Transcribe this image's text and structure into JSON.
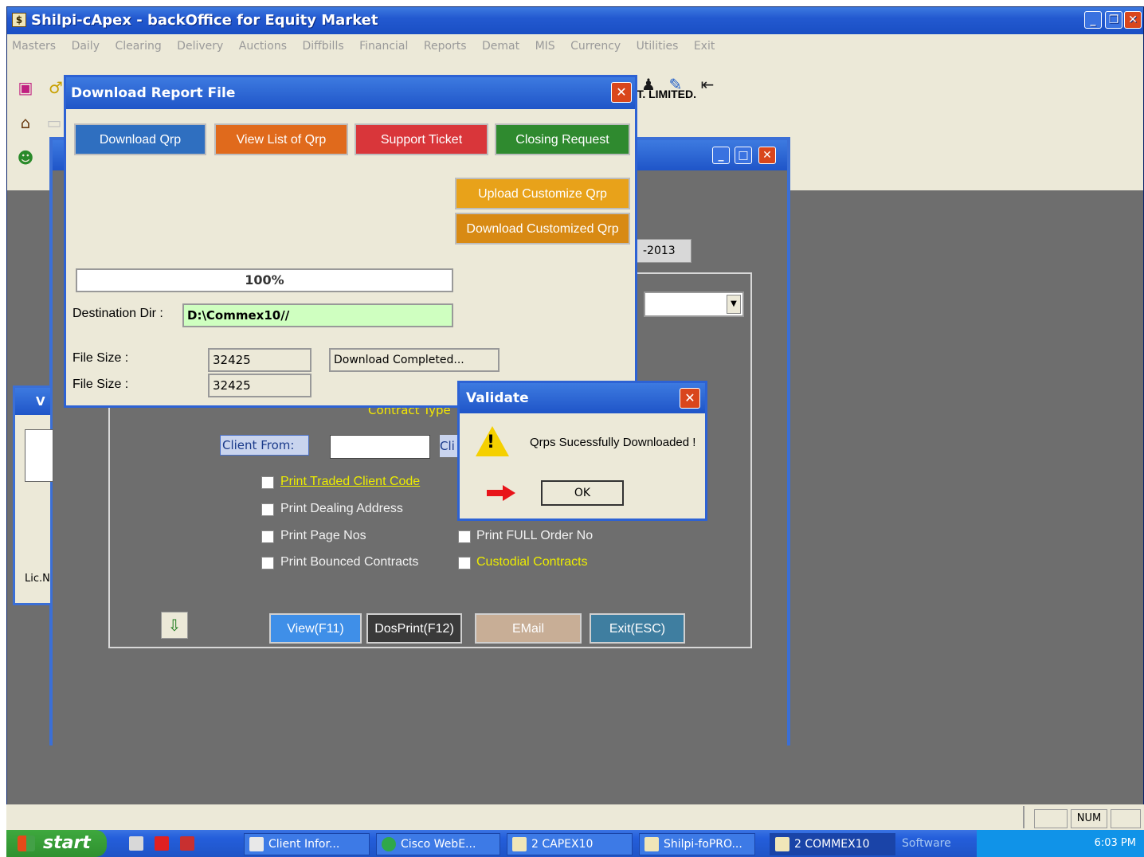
{
  "app": {
    "title": "Shilpi-cApex - backOffice for Equity Market",
    "menu": [
      "Masters",
      "Daily",
      "Clearing",
      "Delivery",
      "Auctions",
      "Diffbills",
      "Financial",
      "Reports",
      "Demat",
      "MIS",
      "Currency",
      "Utilities",
      "Exit"
    ],
    "company_text": "VT. LIMITED."
  },
  "child_window": {
    "date_text": "-2013",
    "contract_type_label": "Contract Type",
    "client_from_label": "Client From:",
    "client_to_label": "Cli",
    "checkboxes": [
      {
        "label": "Print Traded Client Code"
      },
      {
        "label": "Print Dealing Address"
      },
      {
        "label": "Print Page Nos"
      },
      {
        "label": "Print Bounced Contracts"
      },
      {
        "label": "Print FULL Order No"
      },
      {
        "label": "Custodial Contracts"
      }
    ],
    "buttons": {
      "view": "View(F11)",
      "dosprint": "DosPrint(F12)",
      "email": "EMail",
      "exit": "Exit(ESC)"
    },
    "side_title": "V",
    "side_lic": "Lic.N"
  },
  "download_dialog": {
    "title": "Download Report File",
    "buttons": {
      "download_qrp": "Download Qrp",
      "view_list": "View List of Qrp",
      "support_ticket": "Support Ticket",
      "closing_request": "Closing Request",
      "upload_customize": "Upload Customize Qrp",
      "download_customized": "Download Customized Qrp"
    },
    "progress_text": "100%",
    "progress_fraction": 1.0,
    "destination_label": "Destination Dir :",
    "destination_value": "D:\\Commex10//",
    "file_size_label_1": "File Size :",
    "file_size_value_1": "32425",
    "file_size_label_2": "File Size :",
    "file_size_value_2": "32425",
    "status_text": "Download Completed..."
  },
  "validate_dialog": {
    "title": "Validate",
    "message": "Qrps Sucessfully Downloaded !",
    "ok_label": "OK"
  },
  "statusbar": {
    "num": "NUM"
  },
  "taskbar": {
    "start": "start",
    "tasks": [
      "Client Infor...",
      "Cisco WebE...",
      "2 CAPEX10",
      "Shilpi-foPRO...",
      "2 COMMEX10"
    ],
    "software": "Software",
    "clock": "6:03 PM"
  },
  "colors": {
    "title_blue": "#2359d0",
    "download_qrp": "#2f6fc0",
    "view_list": "#e06a1c",
    "support_ticket": "#d9363a",
    "closing_request": "#2f8a2f",
    "upload_customize": "#e8a21a",
    "download_customized": "#d88a14",
    "view_btn": "#3f8fe8",
    "dosprint_btn": "#3a3a3a",
    "email_btn": "#c8ae96",
    "exit_btn": "#3f7ea0"
  }
}
